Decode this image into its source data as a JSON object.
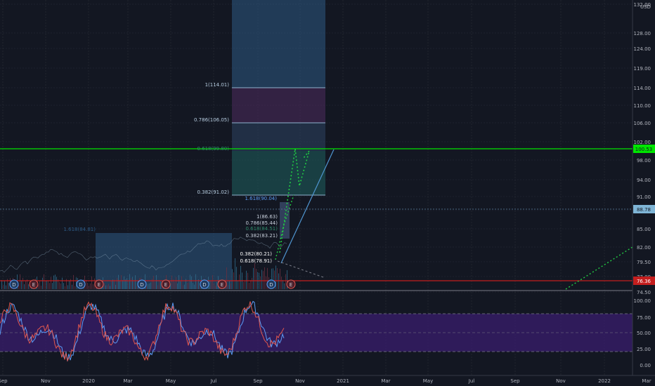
{
  "price_axis": {
    "currency": "USD",
    "ticks": [
      "132.00",
      "128.00",
      "124.00",
      "119.00",
      "114.00",
      "110.00",
      "106.00",
      "102.00",
      "98.00",
      "94.00",
      "91.00",
      "88.00",
      "85.00",
      "82.00",
      "79.50",
      "77.00",
      "74.50"
    ],
    "price_badges": [
      {
        "value": "100.53",
        "color": "#00e600",
        "text_color": "#131722"
      },
      {
        "value": "88.78",
        "color": "#7fb5d6",
        "text_color": "#131722"
      },
      {
        "value": "76.36",
        "color": "#c41e1e",
        "text_color": "#ffffff"
      }
    ]
  },
  "oscillator_axis": {
    "ticks": [
      "100.00",
      "75.00",
      "50.00",
      "25.00",
      "0.00"
    ]
  },
  "time_axis": {
    "ticks": [
      "Sep",
      "Nov",
      "2020",
      "Mar",
      "May",
      "Jul",
      "Sep",
      "Nov",
      "2021",
      "Mar",
      "May",
      "Jul",
      "Sep",
      "Nov",
      "2022",
      "Mar"
    ]
  },
  "fib_labels_upper": [
    "1(114.01)",
    "0.786(106.05)",
    "0.618(99.80)",
    "0.382(91.02)",
    "1.618(90.04)"
  ],
  "fib_labels_inner": [
    "1(86.63)",
    "0.786(85.44)",
    "0.618(84.51)",
    "0.382(83.21)",
    "0.382(80.21)",
    "0.618(78.91)"
  ],
  "fib_label_left": "1.618(84.81)",
  "event_markers": [
    "D",
    "E",
    "D",
    "E",
    "D",
    "E",
    "D",
    "E",
    "D",
    "E",
    "D",
    "E"
  ],
  "colors": {
    "background": "#131722",
    "grid": "#2a2e39",
    "axis_text": "#b2b5be",
    "green_line": "#00e600",
    "red_line": "#c41e1e",
    "blue_zone": "#2d5a84",
    "teal_zone": "#1e5a5a",
    "purple_zone": "#4a2a5a",
    "oscillator_band": "#3a1d6e",
    "stoch_k": "#5b9cf6",
    "stoch_d": "#e0574f"
  }
}
